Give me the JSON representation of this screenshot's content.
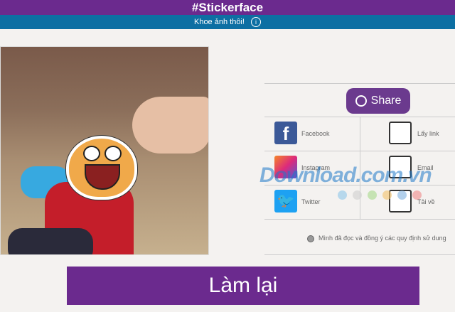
{
  "header": {
    "title": "#Stickerface"
  },
  "subbar": {
    "text": "Khoe ảnh thôi!",
    "info_icon": "i"
  },
  "share": {
    "label": "Share"
  },
  "options": [
    {
      "label": "Facebook",
      "icon": "facebook-icon"
    },
    {
      "label": "Lấy link",
      "icon": "globe-icon"
    },
    {
      "label": "Instagram",
      "icon": "instagram-icon"
    },
    {
      "label": "Email",
      "icon": "mail-icon"
    },
    {
      "label": "Twitter",
      "icon": "twitter-icon"
    },
    {
      "label": "Tải về",
      "icon": "download-icon"
    }
  ],
  "agreement": {
    "text": "Mình đã đọc và đồng ý các quy định sử dung"
  },
  "watermark": "Download.com.vn",
  "retry": {
    "label": "Làm lại"
  },
  "colors": {
    "brand": "#6b2a8e",
    "subbar": "#0d6fa3"
  }
}
